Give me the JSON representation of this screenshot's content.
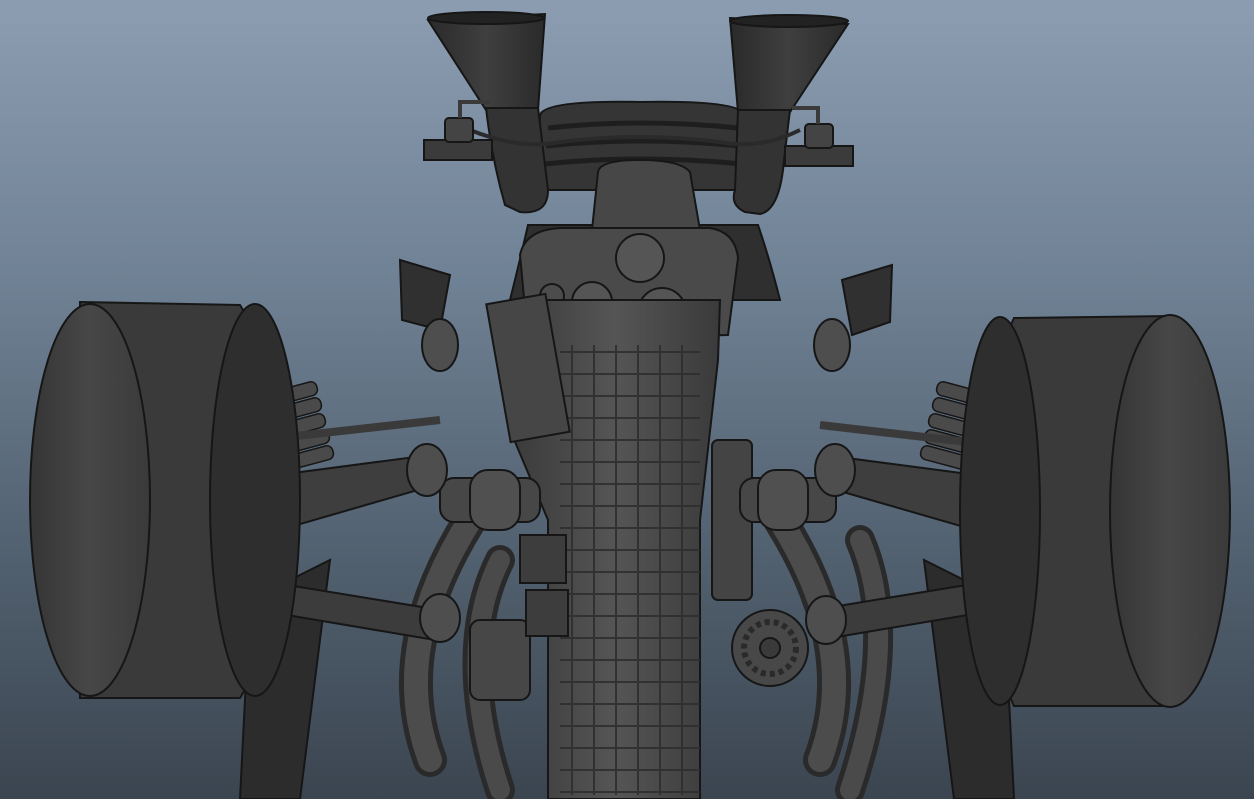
{
  "viewport": {
    "view": "perspective",
    "background_top": "#8c9db2",
    "background_bottom": "#3b4550",
    "shading": "default-gray",
    "text": []
  },
  "model": {
    "subject": "race-car-rear-suspension-and-gearbox",
    "parts": [
      "left-rear-tire",
      "right-rear-tire",
      "left-air-intake",
      "right-air-intake",
      "left-sensor-bracket",
      "right-sensor-bracket",
      "airbox",
      "gearbox-cover",
      "gearbox-casing",
      "left-driveshaft",
      "right-driveshaft",
      "left-coilover-spring",
      "right-coilover-spring",
      "left-upper-wishbone",
      "right-upper-wishbone",
      "left-lower-wishbone",
      "right-lower-wishbone",
      "left-exhaust-pipes",
      "right-exhaust-pipes",
      "alternator",
      "oil-pump"
    ]
  },
  "colors": {
    "tire_face": "#3f3f3f",
    "tire_tread": "#4b4b4b",
    "metal_dark": "#2b2b2b",
    "metal_mid": "#4a4a4a",
    "metal_light": "#5c5c5c",
    "outline": "#161616"
  }
}
